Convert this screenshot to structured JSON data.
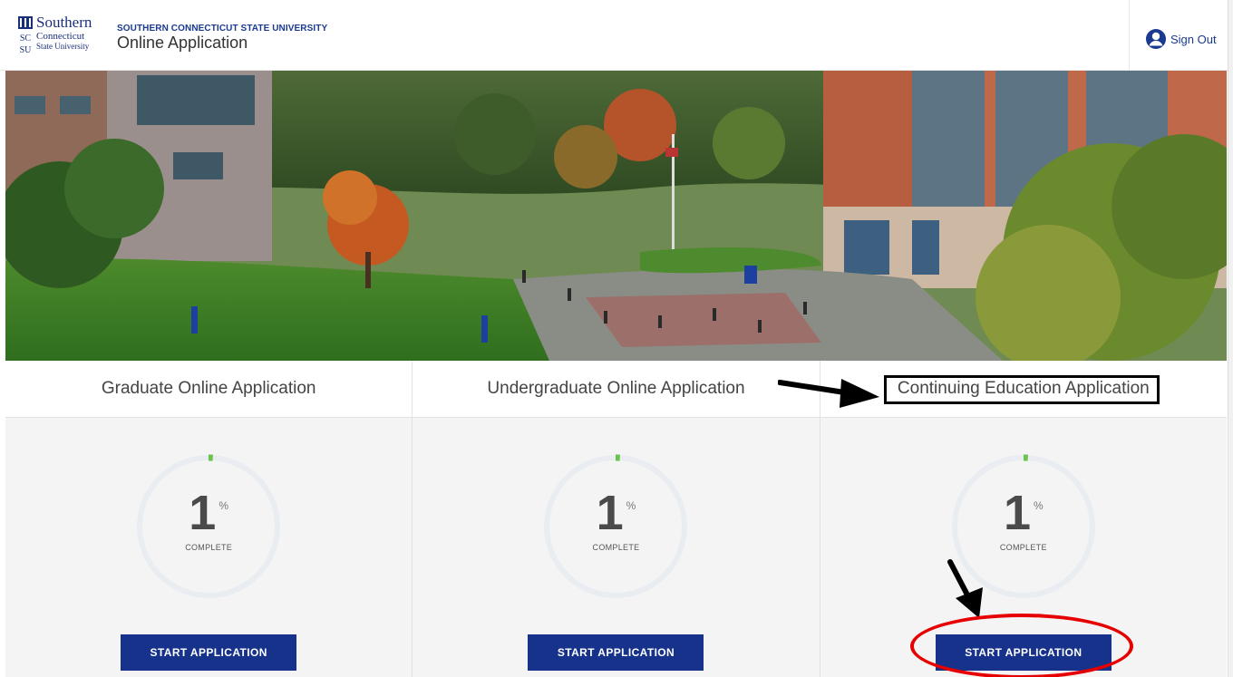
{
  "header": {
    "logo": {
      "line1": "Southern",
      "line2": "Connecticut",
      "line3": "State University",
      "mark_letters": [
        "SC",
        "SU"
      ]
    },
    "university_name": "SOUTHERN CONNECTICUT STATE UNIVERSITY",
    "app_title": "Online Application",
    "sign_out_label": "Sign Out",
    "sign_out_icon": "user-circle-icon"
  },
  "hero": {
    "description_icon": "campus-photo"
  },
  "cards": [
    {
      "title": "Graduate Online Application",
      "percent": "1",
      "percent_symbol": "%",
      "progress_percent": 1,
      "complete_label": "COMPLETE",
      "button_label": "START APPLICATION"
    },
    {
      "title": "Undergraduate Online Application",
      "percent": "1",
      "percent_symbol": "%",
      "progress_percent": 1,
      "complete_label": "COMPLETE",
      "button_label": "START APPLICATION"
    },
    {
      "title": "Continuing Education Application",
      "percent": "1",
      "percent_symbol": "%",
      "progress_percent": 1,
      "complete_label": "COMPLETE",
      "button_label": "START APPLICATION"
    }
  ],
  "colors": {
    "brand_navy": "#16328a",
    "progress_green": "#6cc24a",
    "ring_track": "#e9edf1",
    "annotation_red": "#e60000",
    "annotation_black": "#000000"
  }
}
